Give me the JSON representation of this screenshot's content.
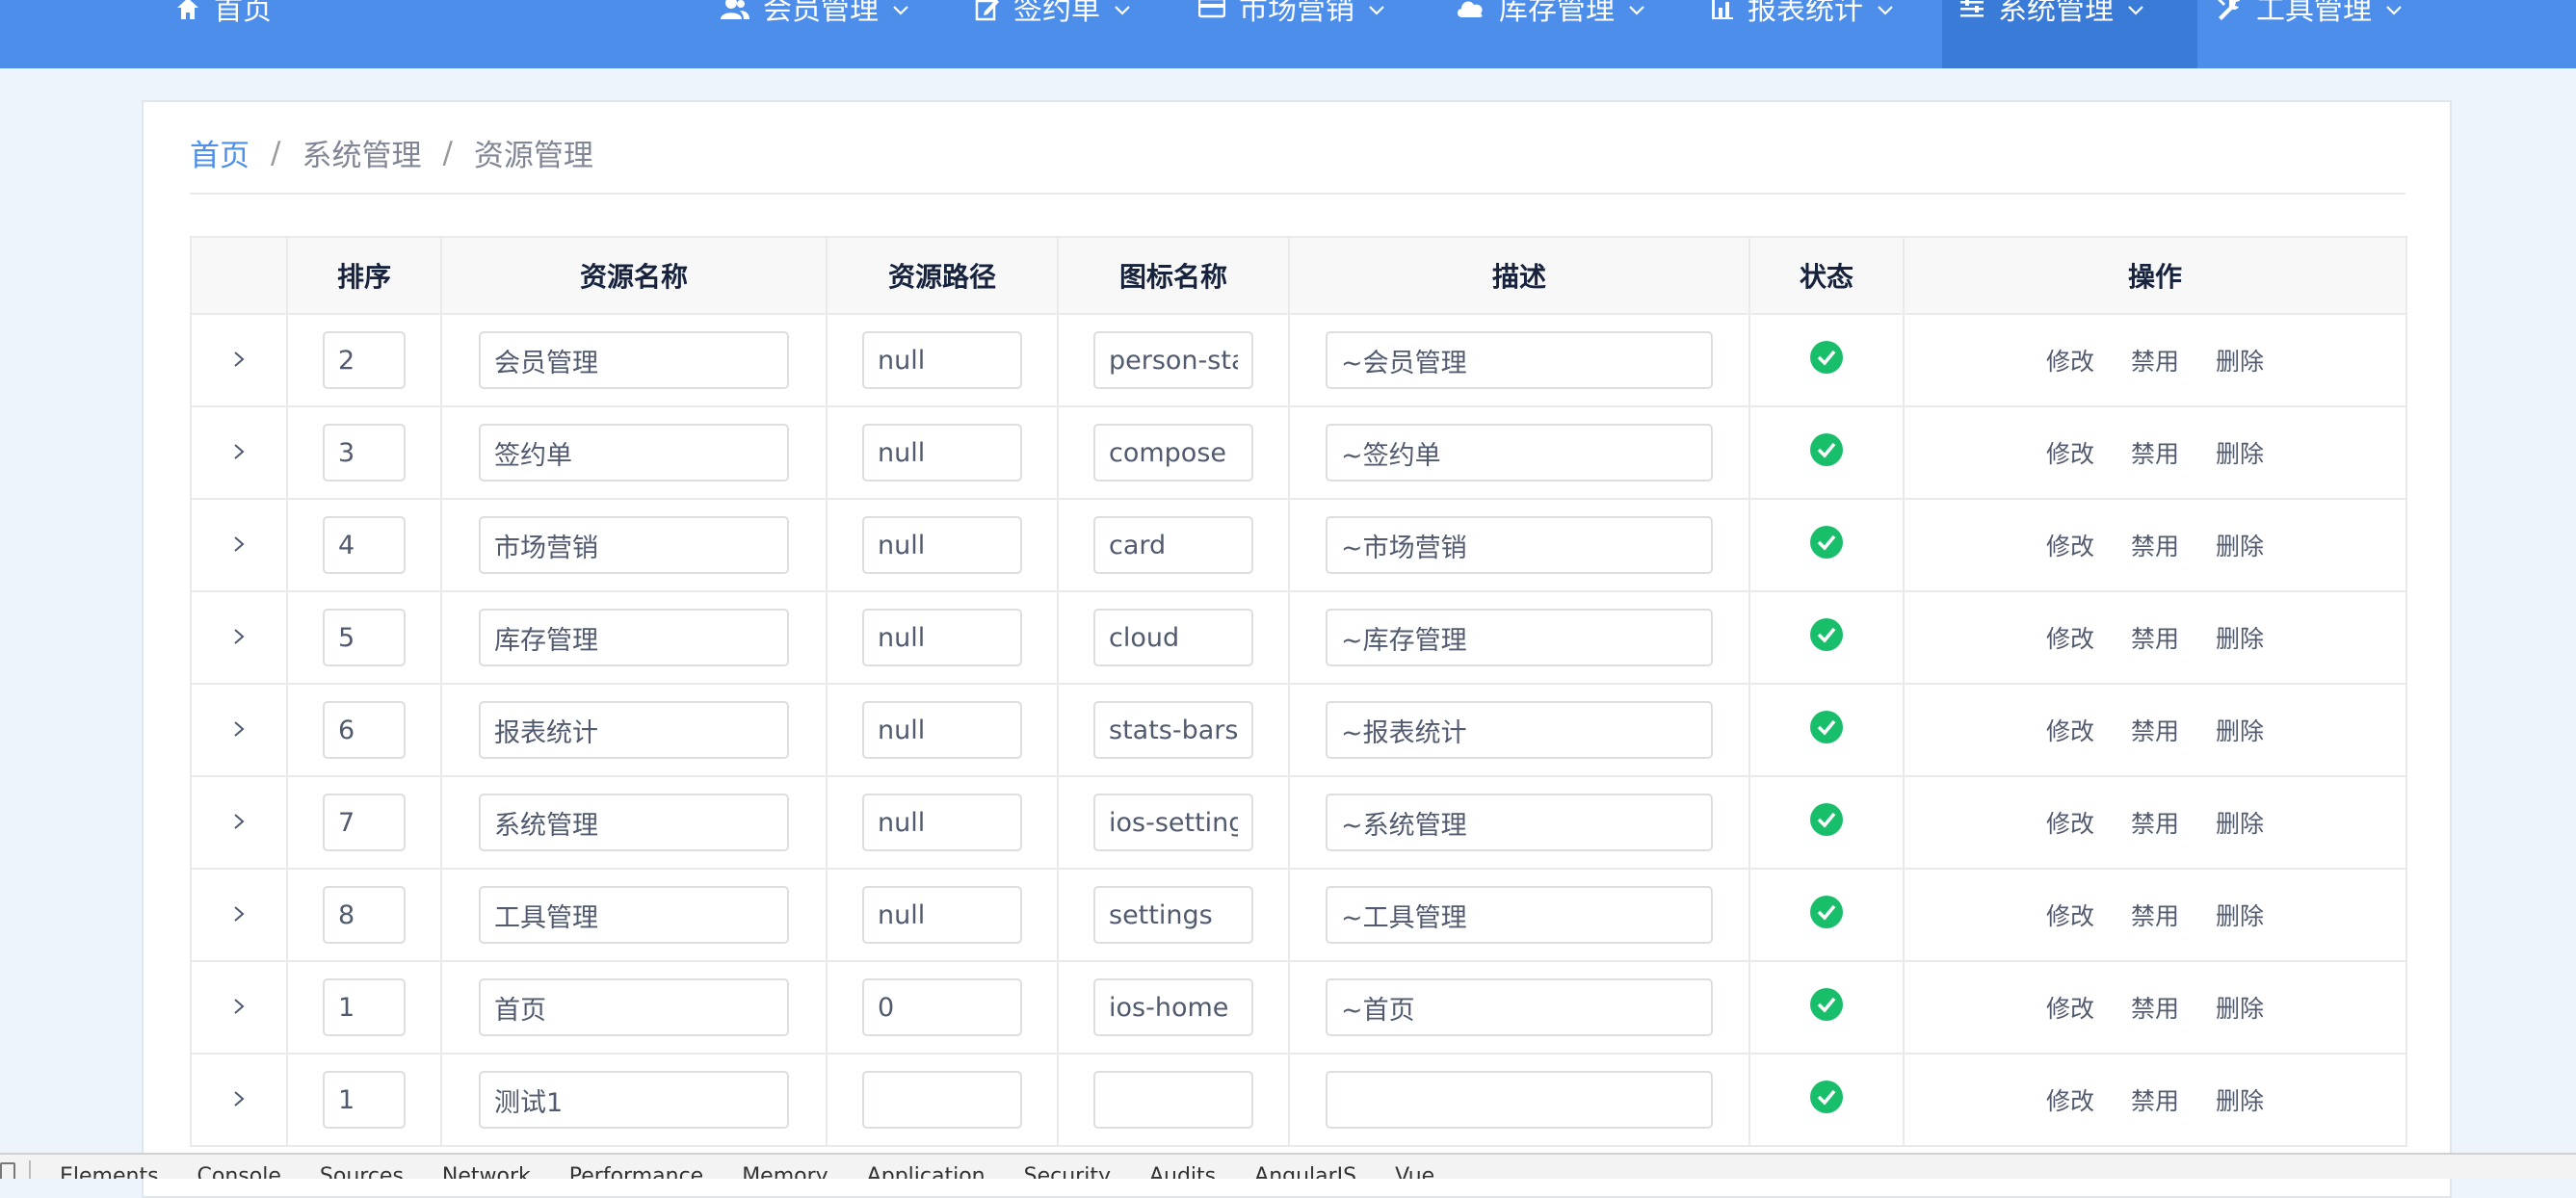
{
  "nav": {
    "home": "首页",
    "items": [
      {
        "label": "会员管理",
        "icon": "users-icon"
      },
      {
        "label": "签约单",
        "icon": "edit-icon"
      },
      {
        "label": "市场营销",
        "icon": "card-icon"
      },
      {
        "label": "库存管理",
        "icon": "cloud-icon"
      },
      {
        "label": "报表统计",
        "icon": "stats-bars-icon"
      },
      {
        "label": "系统管理",
        "icon": "settings-sliders-icon",
        "active": true
      },
      {
        "label": "工具管理",
        "icon": "tools-icon"
      }
    ]
  },
  "breadcrumb": {
    "home": "首页",
    "sep": "/",
    "level1": "系统管理",
    "level2": "资源管理"
  },
  "table": {
    "headers": [
      "",
      "排序",
      "资源名称",
      "资源路径",
      "图标名称",
      "描述",
      "状态",
      "操作"
    ],
    "rows": [
      {
        "sort": "2",
        "name": "会员管理",
        "path": "null",
        "icon": "person-stalker",
        "desc": "~会员管理"
      },
      {
        "sort": "3",
        "name": "签约单",
        "path": "null",
        "icon": "compose",
        "desc": "~签约单"
      },
      {
        "sort": "4",
        "name": "市场营销",
        "path": "null",
        "icon": "card",
        "desc": "~市场营销"
      },
      {
        "sort": "5",
        "name": "库存管理",
        "path": "null",
        "icon": "cloud",
        "desc": "~库存管理"
      },
      {
        "sort": "6",
        "name": "报表统计",
        "path": "null",
        "icon": "stats-bars",
        "desc": "~报表统计"
      },
      {
        "sort": "7",
        "name": "系统管理",
        "path": "null",
        "icon": "ios-settings",
        "desc": "~系统管理"
      },
      {
        "sort": "8",
        "name": "工具管理",
        "path": "null",
        "icon": "settings",
        "desc": "~工具管理"
      },
      {
        "sort": "1",
        "name": "首页",
        "path": "0",
        "icon": "ios-home",
        "desc": "~首页"
      },
      {
        "sort": "1",
        "name": "测试1",
        "path": "",
        "icon": "",
        "desc": ""
      }
    ],
    "actions": {
      "edit": "修改",
      "disable": "禁用",
      "delete": "删除"
    }
  },
  "devtools": {
    "tabs": [
      "Elements",
      "Console",
      "Sources",
      "Network",
      "Performance",
      "Memory",
      "Application",
      "Security",
      "Audits",
      "AngularJS",
      "Vue"
    ]
  },
  "colors": {
    "nav_bg": "#4c8eea",
    "nav_active_bg": "#3b7bd8",
    "status_ok": "#19be6b",
    "link": "#4c8eea"
  }
}
